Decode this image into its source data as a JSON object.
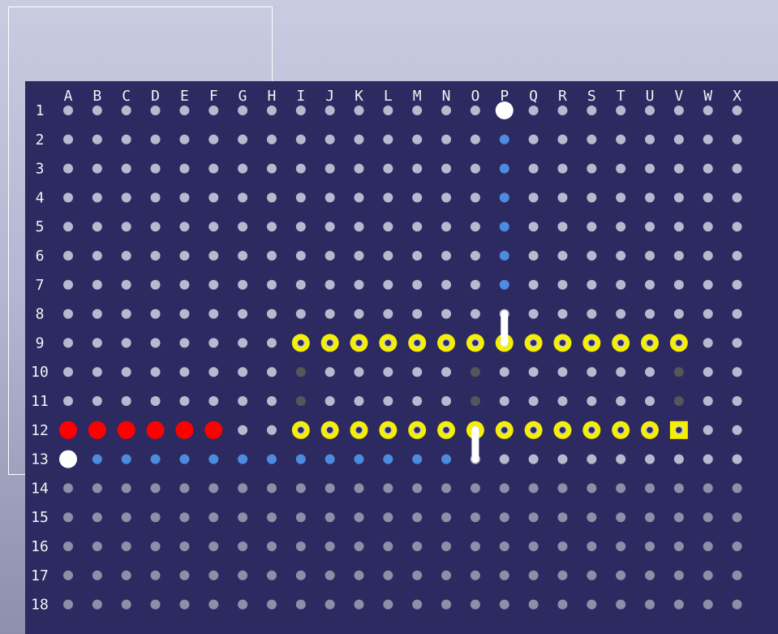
{
  "columns": [
    "A",
    "B",
    "C",
    "D",
    "E",
    "F",
    "G",
    "H",
    "I",
    "J",
    "K",
    "L",
    "M",
    "N",
    "O",
    "P",
    "Q",
    "R",
    "S",
    "T",
    "U",
    "V",
    "W",
    "X"
  ],
  "rows": [
    "1",
    "2",
    "3",
    "4",
    "5",
    "6",
    "7",
    "8",
    "9",
    "10",
    "11",
    "12",
    "13",
    "14",
    "15",
    "16",
    "17",
    "18"
  ],
  "colors": {
    "board": "#2c2a60",
    "hole": "#b8b8cf",
    "hole_dim": "#8e8ea8",
    "blue_hole": "#4d8be0",
    "red_pin": "#ff0000",
    "yellow_pin": "#f5f000",
    "white_pin": "#ffffff",
    "dark_mark": "#55555a"
  },
  "pieces": {
    "white_markers": [
      "P1",
      "A13"
    ],
    "blue_holes": [
      "P2",
      "P3",
      "P4",
      "P5",
      "P6",
      "P7",
      "B13",
      "C13",
      "D13",
      "E13",
      "F13",
      "G13",
      "H13",
      "I13",
      "J13",
      "K13",
      "L13",
      "M13",
      "N13"
    ],
    "red_pins": [
      "A12",
      "B12",
      "C12",
      "D12",
      "E12",
      "F12"
    ],
    "yellow_ring_pins": [
      "I9",
      "J9",
      "K9",
      "L9",
      "M9",
      "N9",
      "O9",
      "P9",
      "Q9",
      "R9",
      "S9",
      "T9",
      "U9",
      "V9",
      "I12",
      "J12",
      "K12",
      "L12",
      "M12",
      "N12",
      "O12",
      "P12",
      "Q12",
      "R12",
      "S12",
      "T12",
      "U12"
    ],
    "yellow_square_pins": [
      "V12"
    ],
    "dark_marks": [
      "I10",
      "I11",
      "O10",
      "O11",
      "V10",
      "V11"
    ],
    "wires": [
      {
        "from": "P8",
        "to": "P9"
      },
      {
        "from": "O12",
        "to": "O13"
      }
    ]
  }
}
